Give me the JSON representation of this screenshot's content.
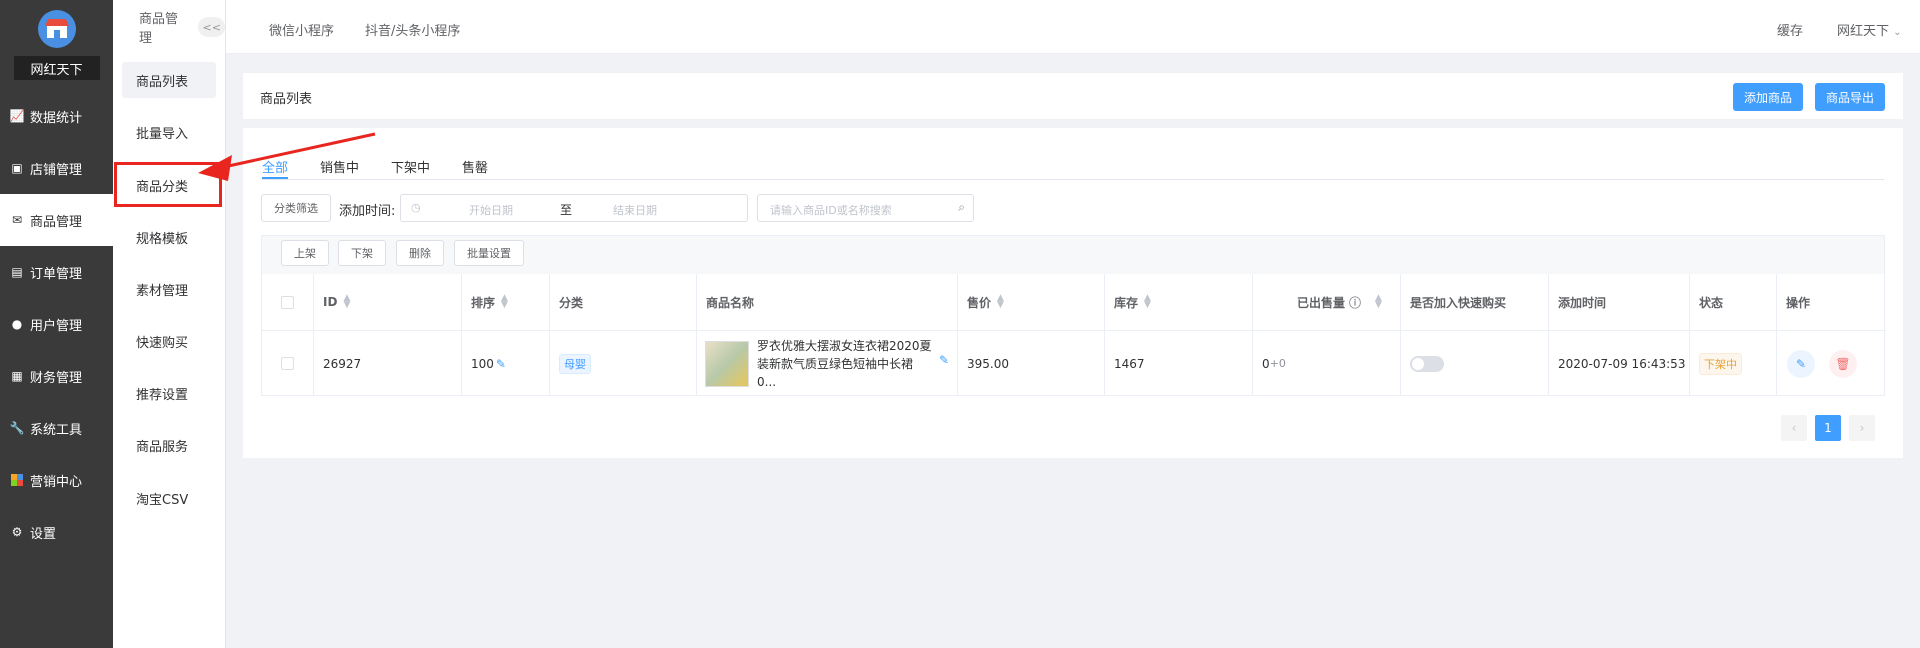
{
  "brand": {
    "name": "网红天下"
  },
  "nav_primary": [
    {
      "label": "数据统计",
      "icon": "chart-icon"
    },
    {
      "label": "店铺管理",
      "icon": "store-icon"
    },
    {
      "label": "商品管理",
      "icon": "goods-icon",
      "active": true
    },
    {
      "label": "订单管理",
      "icon": "order-icon"
    },
    {
      "label": "用户管理",
      "icon": "user-icon"
    },
    {
      "label": "财务管理",
      "icon": "finance-icon"
    },
    {
      "label": "系统工具",
      "icon": "wrench-icon"
    },
    {
      "label": "营销中心",
      "icon": "marketing-icon"
    },
    {
      "label": "设置",
      "icon": "gear-icon"
    }
  ],
  "nav_secondary": {
    "title": "商品管理",
    "collapse": "<<",
    "items": [
      "商品列表",
      "批量导入",
      "商品分类",
      "规格模板",
      "素材管理",
      "快速购买",
      "推荐设置",
      "商品服务",
      "淘宝CSV"
    ]
  },
  "topbar": {
    "tabs": [
      "微信小程序",
      "抖音/头条小程序"
    ],
    "cache": "缓存",
    "user": "网红天下"
  },
  "page": {
    "title": "商品列表",
    "add_btn": "添加商品",
    "export_btn": "商品导出"
  },
  "tabs": [
    "全部",
    "销售中",
    "下架中",
    "售罄"
  ],
  "filters": {
    "category_btn": "分类筛选",
    "date_label": "添加时间:",
    "start_ph": "开始日期",
    "to": "至",
    "end_ph": "结束日期",
    "search_ph": "请输入商品ID或名称搜索"
  },
  "bulk_actions": [
    "上架",
    "下架",
    "删除",
    "批量设置"
  ],
  "table": {
    "headers": [
      "ID",
      "排序",
      "分类",
      "商品名称",
      "售价",
      "库存",
      "已出售量",
      "是否加入快速购买",
      "添加时间",
      "状态",
      "操作"
    ],
    "rows": [
      {
        "id": "26927",
        "sort": "100",
        "category": "母婴",
        "name": "罗衣优雅大摆淑女连衣裙2020夏装新款气质豆绿色短袖中长裙0...",
        "price": "395.00",
        "stock": "1467",
        "sold": "0",
        "sold_extra": "+0",
        "added": "2020-07-09 16:43:53",
        "status": "下架中"
      }
    ]
  },
  "pagination": {
    "prev": "‹",
    "current": "1",
    "next": "›"
  },
  "colors": {
    "primary": "#409eff",
    "sidebar": "#3a3a3a",
    "annotation": "#e8261f"
  }
}
